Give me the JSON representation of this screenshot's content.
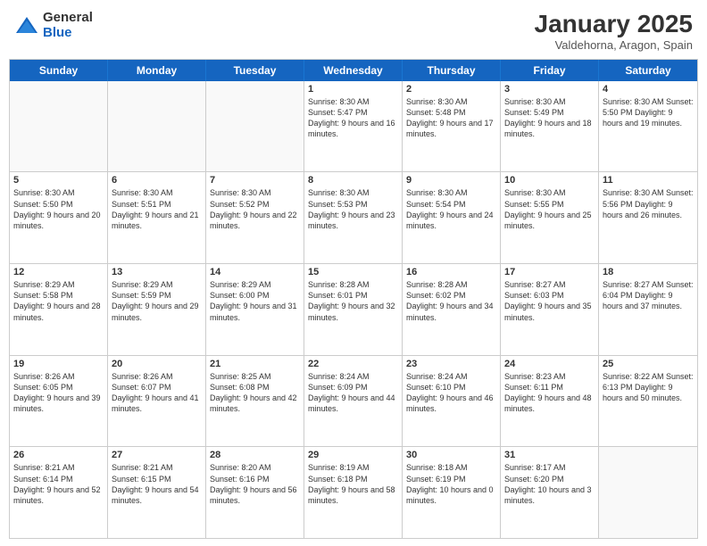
{
  "logo": {
    "general": "General",
    "blue": "Blue"
  },
  "header": {
    "month": "January 2025",
    "location": "Valdehorna, Aragon, Spain"
  },
  "day_headers": [
    "Sunday",
    "Monday",
    "Tuesday",
    "Wednesday",
    "Thursday",
    "Friday",
    "Saturday"
  ],
  "weeks": [
    [
      {
        "num": "",
        "empty": true,
        "info": ""
      },
      {
        "num": "",
        "empty": true,
        "info": ""
      },
      {
        "num": "",
        "empty": true,
        "info": ""
      },
      {
        "num": "1",
        "info": "Sunrise: 8:30 AM\nSunset: 5:47 PM\nDaylight: 9 hours\nand 16 minutes."
      },
      {
        "num": "2",
        "info": "Sunrise: 8:30 AM\nSunset: 5:48 PM\nDaylight: 9 hours\nand 17 minutes."
      },
      {
        "num": "3",
        "info": "Sunrise: 8:30 AM\nSunset: 5:49 PM\nDaylight: 9 hours\nand 18 minutes."
      },
      {
        "num": "4",
        "info": "Sunrise: 8:30 AM\nSunset: 5:50 PM\nDaylight: 9 hours\nand 19 minutes."
      }
    ],
    [
      {
        "num": "5",
        "info": "Sunrise: 8:30 AM\nSunset: 5:50 PM\nDaylight: 9 hours\nand 20 minutes."
      },
      {
        "num": "6",
        "info": "Sunrise: 8:30 AM\nSunset: 5:51 PM\nDaylight: 9 hours\nand 21 minutes."
      },
      {
        "num": "7",
        "info": "Sunrise: 8:30 AM\nSunset: 5:52 PM\nDaylight: 9 hours\nand 22 minutes."
      },
      {
        "num": "8",
        "info": "Sunrise: 8:30 AM\nSunset: 5:53 PM\nDaylight: 9 hours\nand 23 minutes."
      },
      {
        "num": "9",
        "info": "Sunrise: 8:30 AM\nSunset: 5:54 PM\nDaylight: 9 hours\nand 24 minutes."
      },
      {
        "num": "10",
        "info": "Sunrise: 8:30 AM\nSunset: 5:55 PM\nDaylight: 9 hours\nand 25 minutes."
      },
      {
        "num": "11",
        "info": "Sunrise: 8:30 AM\nSunset: 5:56 PM\nDaylight: 9 hours\nand 26 minutes."
      }
    ],
    [
      {
        "num": "12",
        "info": "Sunrise: 8:29 AM\nSunset: 5:58 PM\nDaylight: 9 hours\nand 28 minutes."
      },
      {
        "num": "13",
        "info": "Sunrise: 8:29 AM\nSunset: 5:59 PM\nDaylight: 9 hours\nand 29 minutes."
      },
      {
        "num": "14",
        "info": "Sunrise: 8:29 AM\nSunset: 6:00 PM\nDaylight: 9 hours\nand 31 minutes."
      },
      {
        "num": "15",
        "info": "Sunrise: 8:28 AM\nSunset: 6:01 PM\nDaylight: 9 hours\nand 32 minutes."
      },
      {
        "num": "16",
        "info": "Sunrise: 8:28 AM\nSunset: 6:02 PM\nDaylight: 9 hours\nand 34 minutes."
      },
      {
        "num": "17",
        "info": "Sunrise: 8:27 AM\nSunset: 6:03 PM\nDaylight: 9 hours\nand 35 minutes."
      },
      {
        "num": "18",
        "info": "Sunrise: 8:27 AM\nSunset: 6:04 PM\nDaylight: 9 hours\nand 37 minutes."
      }
    ],
    [
      {
        "num": "19",
        "info": "Sunrise: 8:26 AM\nSunset: 6:05 PM\nDaylight: 9 hours\nand 39 minutes."
      },
      {
        "num": "20",
        "info": "Sunrise: 8:26 AM\nSunset: 6:07 PM\nDaylight: 9 hours\nand 41 minutes."
      },
      {
        "num": "21",
        "info": "Sunrise: 8:25 AM\nSunset: 6:08 PM\nDaylight: 9 hours\nand 42 minutes."
      },
      {
        "num": "22",
        "info": "Sunrise: 8:24 AM\nSunset: 6:09 PM\nDaylight: 9 hours\nand 44 minutes."
      },
      {
        "num": "23",
        "info": "Sunrise: 8:24 AM\nSunset: 6:10 PM\nDaylight: 9 hours\nand 46 minutes."
      },
      {
        "num": "24",
        "info": "Sunrise: 8:23 AM\nSunset: 6:11 PM\nDaylight: 9 hours\nand 48 minutes."
      },
      {
        "num": "25",
        "info": "Sunrise: 8:22 AM\nSunset: 6:13 PM\nDaylight: 9 hours\nand 50 minutes."
      }
    ],
    [
      {
        "num": "26",
        "info": "Sunrise: 8:21 AM\nSunset: 6:14 PM\nDaylight: 9 hours\nand 52 minutes."
      },
      {
        "num": "27",
        "info": "Sunrise: 8:21 AM\nSunset: 6:15 PM\nDaylight: 9 hours\nand 54 minutes."
      },
      {
        "num": "28",
        "info": "Sunrise: 8:20 AM\nSunset: 6:16 PM\nDaylight: 9 hours\nand 56 minutes."
      },
      {
        "num": "29",
        "info": "Sunrise: 8:19 AM\nSunset: 6:18 PM\nDaylight: 9 hours\nand 58 minutes."
      },
      {
        "num": "30",
        "info": "Sunrise: 8:18 AM\nSunset: 6:19 PM\nDaylight: 10 hours\nand 0 minutes."
      },
      {
        "num": "31",
        "info": "Sunrise: 8:17 AM\nSunset: 6:20 PM\nDaylight: 10 hours\nand 3 minutes."
      },
      {
        "num": "",
        "empty": true,
        "info": ""
      }
    ]
  ]
}
